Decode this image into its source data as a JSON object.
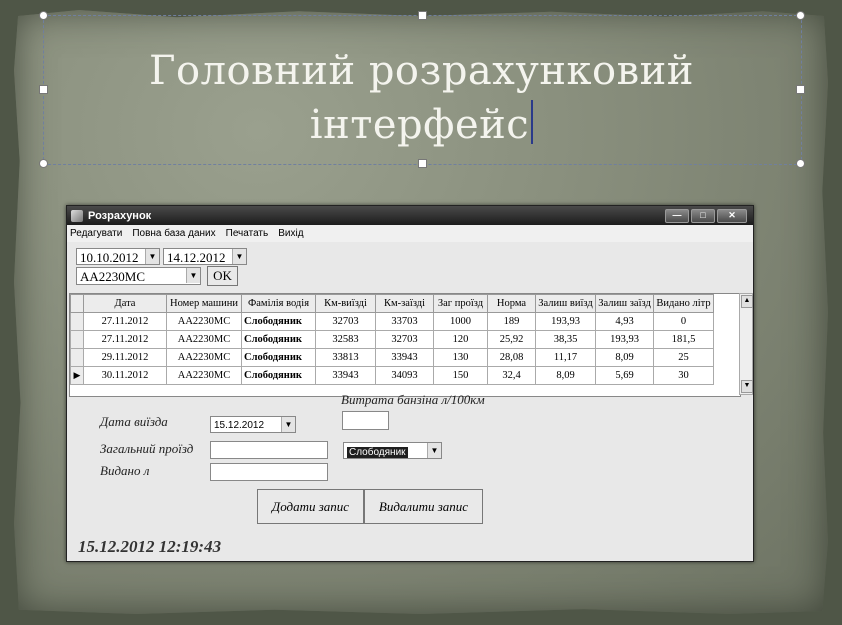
{
  "slide": {
    "title_line1": "Головний розрахунковий",
    "title_line2": "інтерфейс"
  },
  "window": {
    "title": "Розрахунок",
    "controls": {
      "minimize": "—",
      "maximize": "□",
      "close": "✕"
    }
  },
  "menu": [
    "Редагувати",
    "Повна база даних",
    "Печатать",
    "Вихід"
  ],
  "filters": {
    "date_from": "10.10.2012",
    "date_to": "14.12.2012",
    "car_number": "АА2230МС",
    "ok_label": "OK"
  },
  "table": {
    "columns": [
      "Дата",
      "Номер машини",
      "Фамілія водія",
      "Км-виїзді",
      "Км-заїзді",
      "Заг проїзд",
      "Норма",
      "Залиш виїзд",
      "Залиш заїзд",
      "Видано літр"
    ],
    "rows": [
      [
        "27.11.2012",
        "АА2230МС",
        "Слободяник",
        "32703",
        "33703",
        "1000",
        "189",
        "193,93",
        "4,93",
        "0"
      ],
      [
        "27.11.2012",
        "АА2230МС",
        "Слободяник",
        "32583",
        "32703",
        "120",
        "25,92",
        "38,35",
        "193,93",
        "181,5"
      ],
      [
        "29.11.2012",
        "АА2230МС",
        "Слободяник",
        "33813",
        "33943",
        "130",
        "28,08",
        "11,17",
        "8,09",
        "25"
      ],
      [
        "30.11.2012",
        "АА2230МС",
        "Слободяник",
        "33943",
        "34093",
        "150",
        "32,4",
        "8,09",
        "5,69",
        "30"
      ]
    ],
    "current_row_marker": "▶"
  },
  "form": {
    "fuel_rate_label": "Витрата банзіна л/100км",
    "fuel_rate_value": "",
    "departure_date_label": "Дата виїзда",
    "departure_date_value": "15.12.2012",
    "total_distance_label": "Загальний проїзд",
    "total_distance_value": "",
    "issued_label": "Видано л",
    "issued_value": "",
    "driver_value": "Слободяник",
    "add_button": "Додати запис",
    "delete_button": "Видалити запис"
  },
  "status": {
    "datetime": "15.12.2012 12:19:43"
  },
  "icons": {
    "dropdown": "▼",
    "scroll_up": "▲",
    "scroll_down": "▼"
  }
}
